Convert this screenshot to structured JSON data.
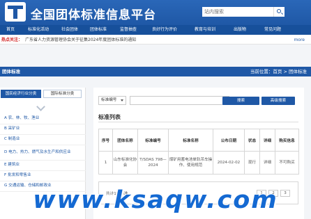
{
  "header": {
    "site_title": "全国团体标准信息平台",
    "search_placeholder": "站内搜索"
  },
  "nav": {
    "items": [
      "首页",
      "标准化活动",
      "社会团体",
      "团体标准",
      "监督抽查",
      "良好行为评价",
      "教育与培训",
      "出版物",
      "常见问题"
    ]
  },
  "notice": {
    "label": "热点关注：",
    "text": "广东省人力资源管理协会关于征集2024年度团体标准的通知",
    "more": "more"
  },
  "breadcrumb": {
    "section": "团体标准",
    "location": "当前位置：首页 > 团体标准"
  },
  "left_tabs": {
    "active": "国民经济行业分类",
    "other": "国际标准分类"
  },
  "categories": [
    "A 农、林、牧、渔业",
    "B 采矿业",
    "C 制造业",
    "D 电力、热力、燃气及水生产和供应业",
    "E 建筑业",
    "F 批发和零售业",
    "G 交通运输、仓储和邮政业"
  ],
  "filter": {
    "selected": "标准编号",
    "search_button": "搜索",
    "advanced_button": "高级搜索"
  },
  "list": {
    "title": "标准列表",
    "headers": [
      "序号",
      "团体名称",
      "标准编号",
      "标准名称",
      "公布日期",
      "状态",
      "详细",
      "购买信息"
    ],
    "rows": [
      {
        "index": "1",
        "org": "山东标准化协会",
        "code": "T/SDAS 798—2024",
        "name": "煤矿用蓄电池单轨吊车操作、使用规范",
        "date": "2024-02-02",
        "status": "现行",
        "detail": "详细",
        "buy": "不可购买"
      }
    ]
  },
  "pager": {
    "total": "共计1条标准",
    "buttons": [
      "1",
      "2",
      "3"
    ]
  },
  "watermark": "www.ksaqw.com"
}
